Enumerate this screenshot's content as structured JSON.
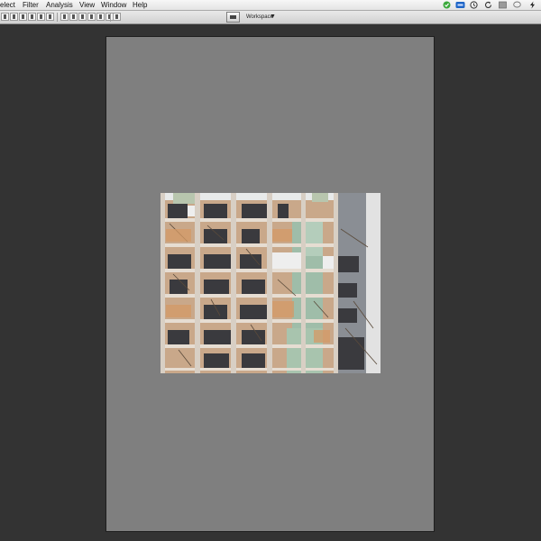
{
  "menubar": {
    "items": [
      {
        "label": "elect"
      },
      {
        "label": "Filter"
      },
      {
        "label": "Analysis"
      },
      {
        "label": "View"
      },
      {
        "label": "Window"
      },
      {
        "label": "Help"
      }
    ],
    "status_icons": [
      {
        "name": "evernote-icon",
        "color": "#3aa83a"
      },
      {
        "name": "notification-badge-icon",
        "color": "#1f66c7"
      },
      {
        "name": "time-machine-icon"
      },
      {
        "name": "sync-icon"
      },
      {
        "name": "screen-icon"
      },
      {
        "name": "bubble-icon"
      },
      {
        "name": "lightning-icon"
      }
    ]
  },
  "options_bar": {
    "align_buttons_group1": 6,
    "align_buttons_group2": 6,
    "align_buttons_group3": 1,
    "workspace_button_icon": "screen-mode-icon",
    "workspace_label": "Workspace",
    "workspace_arrow": "▼"
  },
  "document": {
    "background": "#7f7f7f",
    "photo_subject": "demolished-building-photo"
  }
}
